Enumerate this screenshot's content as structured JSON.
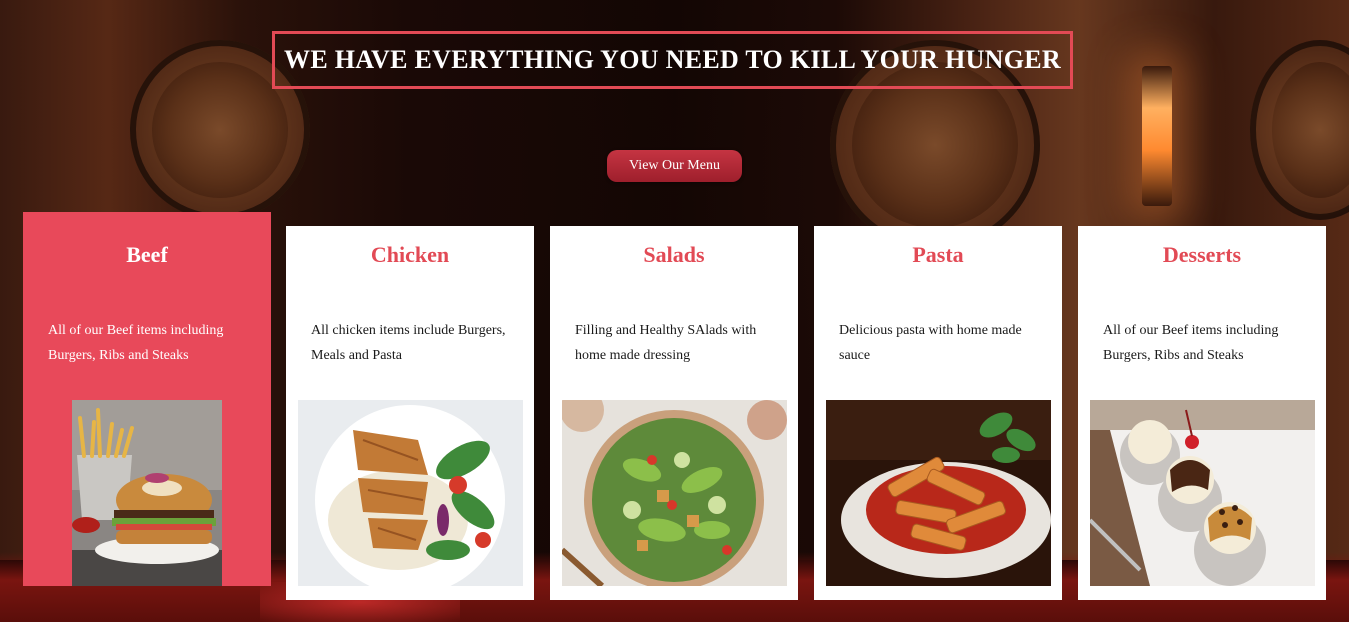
{
  "hero": {
    "headline": "WE HAVE EVERYTHING YOU NEED TO KILL YOUR HUNGER",
    "cta_label": "View Our Menu"
  },
  "colors": {
    "accent": "#e24a55",
    "active_card": "#e8495a",
    "button": "#b02a38"
  },
  "categories": [
    {
      "title": "Beef",
      "description": "All of our Beef items including Burgers, Ribs and Steaks",
      "image": "burger-fries-photo",
      "active": true
    },
    {
      "title": "Chicken",
      "description": "All chicken items include Burgers, Meals and Pasta",
      "image": "grilled-chicken-rice-photo",
      "active": false
    },
    {
      "title": "Salads",
      "description": "Filling and Healthy SAlads with home made dressing",
      "image": "salad-bowl-photo",
      "active": false
    },
    {
      "title": "Pasta",
      "description": "Delicious pasta with home made sauce",
      "image": "penne-pasta-photo",
      "active": false
    },
    {
      "title": "Desserts",
      "description": "All of our Beef items including Burgers, Ribs and Steaks",
      "image": "ice-cream-sundae-photo",
      "active": false
    }
  ]
}
